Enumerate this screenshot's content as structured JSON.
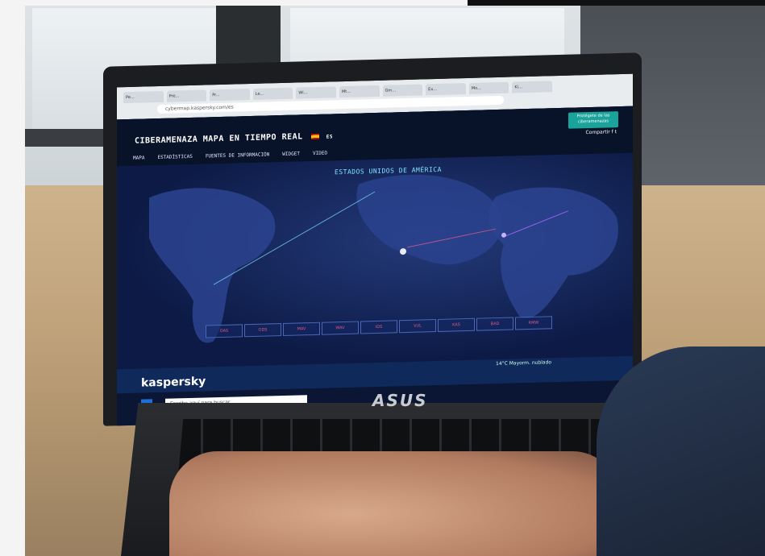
{
  "screen": {
    "browser": {
      "tabs": [
        "Pe...",
        "Pre...",
        "Pr...",
        "Le...",
        "Wi...",
        "Mt...",
        "Gm...",
        "Ex...",
        "Mo...",
        "Ki..."
      ],
      "url": "cybermap.kaspersky.com/es"
    },
    "site": {
      "title": "CIBERAMENAZA MAPA EN TIEMPO REAL",
      "lang_label": "ES",
      "protect_button": "Protégete de las ciberamenazas",
      "share_label": "Compartir",
      "nav": [
        "MAPA",
        "ESTADÍSTICAS",
        "FUENTES DE INFORMACIÓN",
        "WIDGET",
        "VIDEO"
      ],
      "map_title": "ESTADOS UNIDOS DE AMÉRICA",
      "counters": [
        "OAS",
        "ODS",
        "MAV",
        "WAV",
        "IDS",
        "VUL",
        "KAS",
        "BAD",
        "RMW"
      ]
    },
    "taskbar": {
      "brand": "kaspersky",
      "search_placeholder": "Escribe aquí para buscar",
      "weather": "14°C  Mayorm. nublado"
    }
  },
  "laptop": {
    "brand": "ASUS"
  }
}
